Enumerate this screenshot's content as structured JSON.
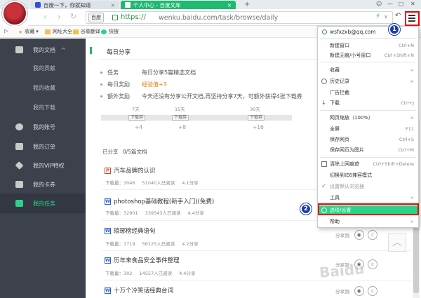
{
  "colors": {
    "accent": "#1fb970",
    "sidebar_bg": "#3c414c",
    "active_green": "#2ad38a",
    "highlight_red": "#e00000",
    "badge_blue": "#1a3da8"
  },
  "tabs": [
    {
      "title": "百度一下，你就知道",
      "icon": "baidu-paw-icon"
    },
    {
      "title": "个人中心 - 百度文库",
      "icon": "wenku-icon"
    }
  ],
  "window": {
    "menu_icon": "hamburger-icon"
  },
  "address": {
    "site_chip": "百度",
    "scheme": "https://",
    "url_rest": "wenku.baidu.com/task/browse/daily"
  },
  "bookmarks": [
    {
      "label": "收藏"
    },
    {
      "label": "网址大全"
    },
    {
      "label": "谷歌翻译"
    },
    {
      "label": "快搜"
    }
  ],
  "sidebar": {
    "items": [
      {
        "label": "我的文档",
        "icon": "document-icon",
        "chevron": "^"
      },
      {
        "label": "我的贡献"
      },
      {
        "label": "我的收藏"
      },
      {
        "label": "我的下载"
      },
      {
        "label": "我的账号",
        "icon": "person-icon"
      },
      {
        "label": "我的订单",
        "icon": "cart-icon"
      },
      {
        "label": "我的VIP特权",
        "icon": "diamond-icon"
      },
      {
        "label": "我的卡券",
        "icon": "card-icon"
      },
      {
        "label": "我的任务",
        "icon": "task-icon"
      }
    ]
  },
  "main": {
    "title": "每日分享",
    "info": [
      {
        "label": "任务",
        "value": "每日分享5篇精选文档"
      },
      {
        "label": "每日奖励",
        "value": "经验值+3"
      },
      {
        "label": "额外奖励",
        "value": "今天还没有分享公开文档,再坚持分享7天，可额外获得4张下载券"
      }
    ],
    "progress": {
      "fraction": 0,
      "checkpoints": [
        {
          "days": "7天",
          "reward": "下载券",
          "plus": "+4"
        },
        {
          "days": "15天",
          "reward": "下载券",
          "plus": "+8"
        },
        {
          "days": "30天",
          "reward": "下载券",
          "plus": "+16"
        }
      ]
    },
    "shared_label": "已分享",
    "shared_count": "0/5篇文档",
    "share_label": "分享到:",
    "docs": [
      {
        "type": "P",
        "title": "汽车品牌的认识",
        "downloads": "下载量：3046",
        "reads": "51040人已阅读",
        "rating": "4.1分享"
      },
      {
        "type": "W",
        "title": "photoshop基础教程(新手入门)(免费)",
        "downloads": "下载量：32901",
        "reads": "339343人已阅读",
        "rating": "4.4分享"
      },
      {
        "type": "W",
        "title": "琅琊榜经典语句",
        "downloads": "下载量：1719",
        "reads": "56125人已阅读",
        "rating": "4.2分享"
      },
      {
        "type": "W",
        "title": "历年来食品安全事件整理",
        "downloads": "下载量：302",
        "reads": "14557人已阅读",
        "rating": "4.4分享"
      },
      {
        "type": "W",
        "title": "十万个冷笑话经典台词",
        "downloads": "",
        "reads": "",
        "rating": ""
      }
    ],
    "watermark": "Baidu"
  },
  "menu": {
    "user": "wsfxzxb@qq.com",
    "items": [
      {
        "label": "新建窗口",
        "shortcut": "Ctrl+N"
      },
      {
        "label": "新建无痕/小号窗口",
        "shortcut": "Ctrl+Shift+N"
      },
      {
        "label": "收藏",
        "shortcut": ">"
      },
      {
        "label": "历史记录",
        "shortcut": ">"
      },
      {
        "label": "广告拦截",
        "shortcut": ""
      },
      {
        "label": "下载",
        "shortcut": "Ctrl+J"
      },
      {
        "label": "网页缩放（100%）",
        "shortcut": ">"
      },
      {
        "label": "全屏",
        "shortcut": "F11"
      },
      {
        "label": "保存网页",
        "shortcut": "Ctrl+S"
      },
      {
        "label": "保存网页为图片",
        "shortcut": "Ctrl+M"
      },
      {
        "label": "清除上网痕迹",
        "shortcut": "Ctrl+Shift+Delete"
      },
      {
        "label": "切换到IE6兼容模式",
        "shortcut": ""
      },
      {
        "label": "设置默认浏览器",
        "shortcut": ""
      },
      {
        "label": "工具",
        "shortcut": ">"
      },
      {
        "label": "选项/设置",
        "shortcut": ""
      },
      {
        "label": "帮助",
        "shortcut": ">"
      }
    ]
  },
  "annotations": {
    "step1": "1",
    "step2": "2"
  }
}
